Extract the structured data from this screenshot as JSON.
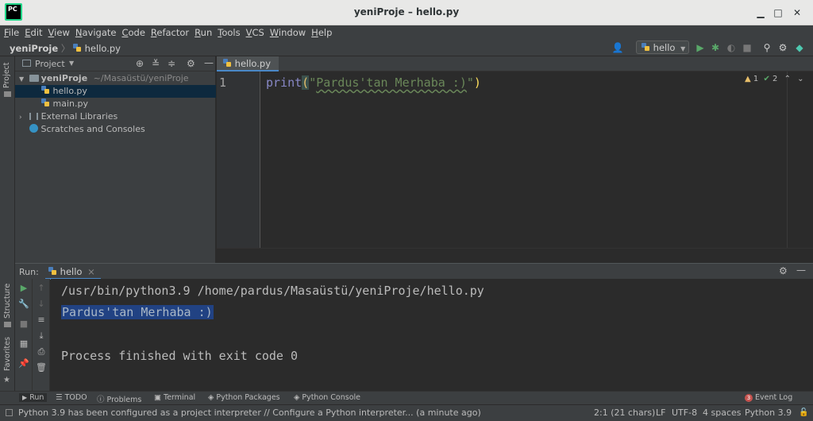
{
  "window": {
    "title": "yeniProje – hello.py",
    "logo_text": "PC",
    "minimize": "▁",
    "maximize": "□",
    "close": "✕"
  },
  "menubar": {
    "items": [
      {
        "u": "F",
        "rest": "ile"
      },
      {
        "u": "E",
        "rest": "dit"
      },
      {
        "u": "V",
        "rest": "iew"
      },
      {
        "u": "N",
        "rest": "avigate"
      },
      {
        "u": "C",
        "rest": "ode"
      },
      {
        "u": "R",
        "rest": "efactor"
      },
      {
        "u": "R",
        "rest": "un"
      },
      {
        "u": "T",
        "rest": "ools"
      },
      {
        "u": "V",
        "rest": "CS"
      },
      {
        "u": "W",
        "rest": "indow"
      },
      {
        "u": "H",
        "rest": "elp"
      }
    ]
  },
  "navbar": {
    "project": "yeniProje",
    "file": "hello.py",
    "run_config": "hello"
  },
  "sidebar": {
    "project_label": "Project",
    "structure_label": "Structure",
    "favorites_label": "Favorites"
  },
  "project_panel": {
    "title": "Project",
    "root_name": "yeniProje",
    "root_path": "~/Masaüstü/yeniProje",
    "files": [
      "hello.py",
      "main.py"
    ],
    "external_libraries": "External Libraries",
    "scratches": "Scratches and Consoles"
  },
  "editor": {
    "tab": "hello.py",
    "line_number": "1",
    "code": {
      "func": "print",
      "open": "(",
      "string_open_quote": "\"",
      "string": "Pardus'tan Merhaba :)",
      "string_close_quote": "\"",
      "close": ")"
    },
    "warnings": "1",
    "checks": "2"
  },
  "run_panel": {
    "label": "Run:",
    "tab": "hello",
    "console": {
      "command": "/usr/bin/python3.9 /home/pardus/Masaüstü/yeniProje/hello.py",
      "output": "Pardus'tan Merhaba :)",
      "finished": "Process finished with exit code 0"
    }
  },
  "tool_windows": {
    "run": "Run",
    "todo": "TODO",
    "problems": "Problems",
    "terminal": "Terminal",
    "python_packages": "Python Packages",
    "python_console": "Python Console",
    "event_log_count": "3",
    "event_log": "Event Log"
  },
  "status_bar": {
    "message": "Python 3.9 has been configured as a project interpreter // Configure a Python interpreter... (a minute ago)",
    "position": "2:1 (21 chars)",
    "line_sep": "LF",
    "encoding": "UTF-8",
    "indent": "4 spaces",
    "interpreter": "Python 3.9"
  },
  "colors": {
    "editor_bg": "#2b2b2b",
    "panel_bg": "#3c3f41",
    "selection": "#214283",
    "accent": "#4a88c7"
  }
}
